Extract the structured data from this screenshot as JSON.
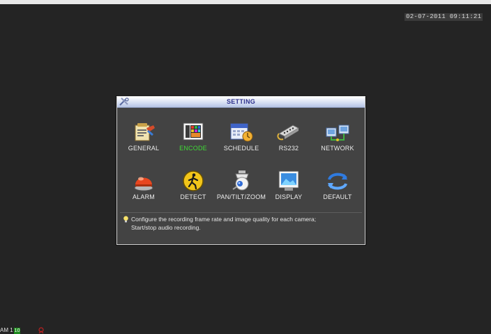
{
  "datetime": "02-07-2011 09:11:21",
  "dialog": {
    "title": "SETTING",
    "items": [
      {
        "label": "GENERAL",
        "icon": "general-icon"
      },
      {
        "label": "ENCODE",
        "icon": "encode-icon",
        "selected": true
      },
      {
        "label": "SCHEDULE",
        "icon": "schedule-icon"
      },
      {
        "label": "RS232",
        "icon": "rs232-icon"
      },
      {
        "label": "NETWORK",
        "icon": "network-icon"
      },
      {
        "label": "ALARM",
        "icon": "alarm-icon"
      },
      {
        "label": "DETECT",
        "icon": "detect-icon"
      },
      {
        "label": "PAN/TILT/ZOOM",
        "icon": "ptz-camera-icon"
      },
      {
        "label": "DISPLAY",
        "icon": "display-icon"
      },
      {
        "label": "DEFAULT",
        "icon": "default-icon"
      }
    ],
    "hint_lines": [
      "Configure the recording frame rate and image quality for each camera;",
      "Start/stop audio recording."
    ]
  },
  "status": {
    "camera_label": "AM 1",
    "rec_badge": "10"
  },
  "colors": {
    "background": "#242424",
    "dialog_bg": "#434343",
    "selected_label": "#3fdc36",
    "title_text": "#2b2f8c"
  }
}
